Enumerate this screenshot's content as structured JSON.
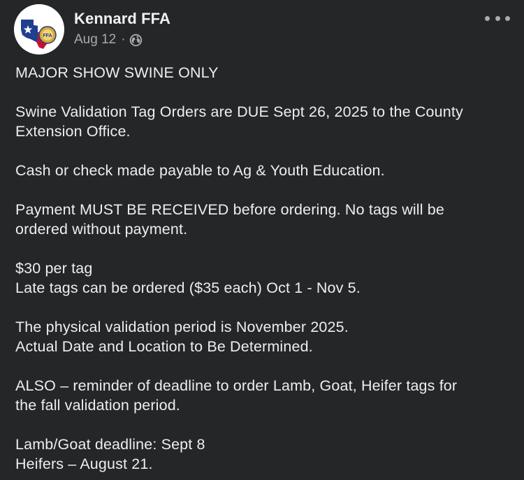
{
  "post": {
    "author": "Kennard FFA",
    "date": "Aug 12",
    "separator": "·",
    "privacy_icon": "globe-icon",
    "more_icon": "more-options-icon",
    "avatar_icon": "texas-ffa-emblem",
    "avatar_text": "FFA",
    "paragraphs": [
      "MAJOR SHOW SWINE ONLY",
      "Swine Validation Tag Orders are DUE Sept 26, 2025 to the County\nExtension Office.",
      "Cash or check made payable to Ag & Youth Education.",
      "Payment MUST BE RECEIVED before ordering.  No tags will be\nordered without payment.",
      "$30 per tag\nLate tags can be ordered ($35 each) Oct 1 - Nov 5.",
      "The physical validation period is November 2025.\nActual Date and Location to Be Determined.",
      "ALSO – reminder of deadline to order Lamb, Goat, Heifer tags for\nthe fall validation period.",
      "Lamb/Goat deadline: Sept 8\nHeifers – August 21."
    ]
  },
  "colors": {
    "background": "#252628",
    "text": "#eceef0",
    "secondary_text": "#a8abaf",
    "texas_blue": "#1f3f8f",
    "texas_red": "#c8102e",
    "ffa_gold": "#d9a92a"
  }
}
